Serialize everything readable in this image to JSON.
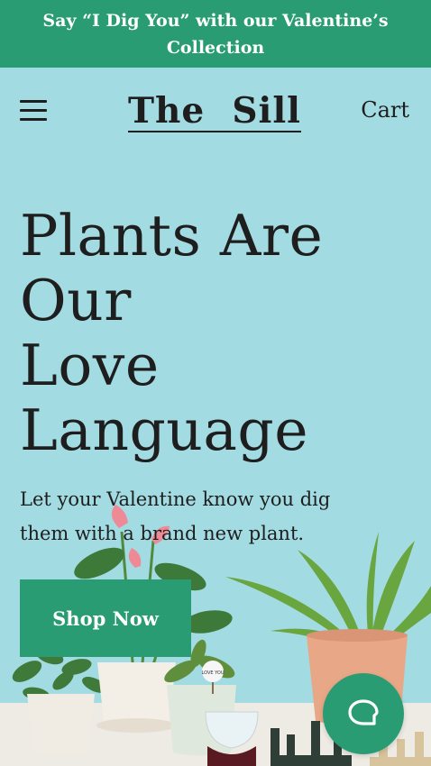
{
  "promo_banner": {
    "text": "Say “I Dig You” with our Valentine’s Collection"
  },
  "header": {
    "logo_word_1": "The",
    "logo_word_2": "Sill",
    "cart_label": "Cart"
  },
  "hero": {
    "title_lines": [
      "Plants Are",
      "Our",
      "Love",
      "Language"
    ],
    "subtitle": "Let your Valentine know you dig them with a brand new plant.",
    "cta_label": "Shop Now",
    "plant_tag_text": "LOVE YOU"
  },
  "colors": {
    "brand_green": "#2a9c74",
    "background": "#a3dbe2",
    "text_dark": "#1e1e1e"
  },
  "icons": {
    "menu": "hamburger-icon",
    "chat": "chat-bubble-icon"
  }
}
